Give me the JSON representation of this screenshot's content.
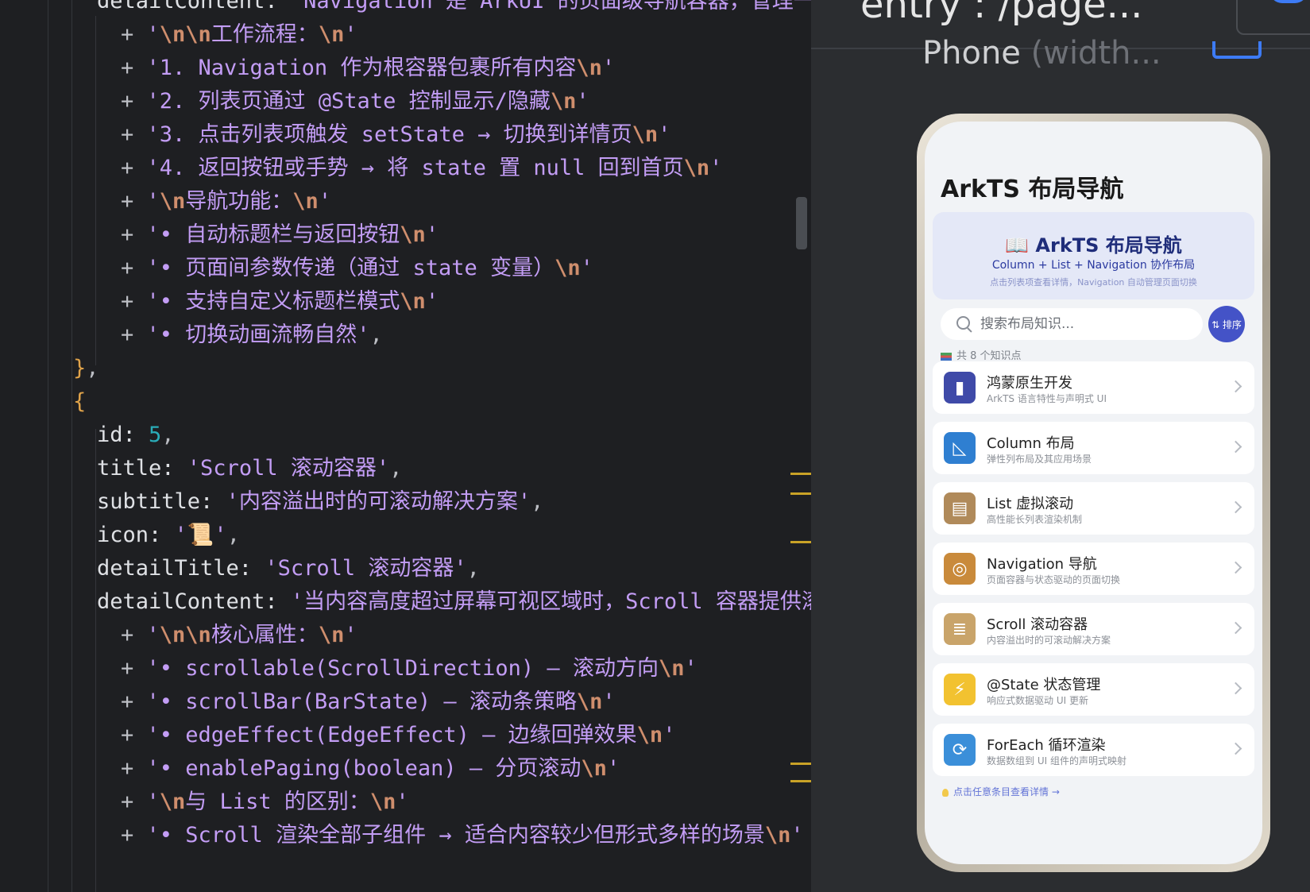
{
  "editor": {
    "lines": [
      {
        "indent": 122,
        "parts": [
          [
            "prop",
            "detailContent: "
          ],
          [
            "str",
            "'Navigation 是 ArkUI 的页面级导航容器，管理一级"
          ]
        ]
      },
      {
        "indent": 152,
        "parts": [
          [
            "plus",
            "+ "
          ],
          [
            "str",
            "'"
          ],
          [
            "esc",
            "\\n\\n"
          ],
          [
            "str",
            "工作流程："
          ],
          [
            "esc",
            "\\n"
          ],
          [
            "str",
            "'"
          ]
        ]
      },
      {
        "indent": 152,
        "parts": [
          [
            "plus",
            "+ "
          ],
          [
            "str",
            "'1. Navigation 作为根容器包裹所有内容"
          ],
          [
            "esc",
            "\\n"
          ],
          [
            "str",
            "'"
          ]
        ]
      },
      {
        "indent": 152,
        "parts": [
          [
            "plus",
            "+ "
          ],
          [
            "str",
            "'2. 列表页通过 @State 控制显示/隐藏"
          ],
          [
            "esc",
            "\\n"
          ],
          [
            "str",
            "'"
          ]
        ]
      },
      {
        "indent": 152,
        "parts": [
          [
            "plus",
            "+ "
          ],
          [
            "str",
            "'3. 点击列表项触发 setState → 切换到详情页"
          ],
          [
            "esc",
            "\\n"
          ],
          [
            "str",
            "'"
          ]
        ]
      },
      {
        "indent": 152,
        "parts": [
          [
            "plus",
            "+ "
          ],
          [
            "str",
            "'4. 返回按钮或手势 → 将 state 置 null 回到首页"
          ],
          [
            "esc",
            "\\n"
          ],
          [
            "str",
            "'"
          ]
        ]
      },
      {
        "indent": 152,
        "parts": [
          [
            "plus",
            "+ "
          ],
          [
            "str",
            "'"
          ],
          [
            "esc",
            "\\n"
          ],
          [
            "str",
            "导航功能："
          ],
          [
            "esc",
            "\\n"
          ],
          [
            "str",
            "'"
          ]
        ]
      },
      {
        "indent": 152,
        "parts": [
          [
            "plus",
            "+ "
          ],
          [
            "str",
            "'• 自动标题栏与返回按钮"
          ],
          [
            "esc",
            "\\n"
          ],
          [
            "str",
            "'"
          ]
        ]
      },
      {
        "indent": 152,
        "parts": [
          [
            "plus",
            "+ "
          ],
          [
            "str",
            "'• 页面间参数传递（通过 state 变量）"
          ],
          [
            "esc",
            "\\n"
          ],
          [
            "str",
            "'"
          ]
        ]
      },
      {
        "indent": 152,
        "parts": [
          [
            "plus",
            "+ "
          ],
          [
            "str",
            "'• 支持自定义标题栏模式"
          ],
          [
            "esc",
            "\\n"
          ],
          [
            "str",
            "'"
          ]
        ]
      },
      {
        "indent": 152,
        "parts": [
          [
            "plus",
            "+ "
          ],
          [
            "str",
            "'• 切换动画流畅自然'"
          ],
          [
            "plus",
            ","
          ]
        ]
      },
      {
        "indent": 92,
        "parts": [
          [
            "brace",
            "}"
          ],
          [
            "plus",
            ","
          ]
        ]
      },
      {
        "indent": 92,
        "parts": [
          [
            "brace",
            "{"
          ]
        ]
      },
      {
        "indent": 122,
        "parts": [
          [
            "prop",
            "id: "
          ],
          [
            "num",
            "5"
          ],
          [
            "plus",
            ","
          ]
        ]
      },
      {
        "indent": 122,
        "parts": [
          [
            "prop",
            "title: "
          ],
          [
            "str",
            "'Scroll 滚动容器'"
          ],
          [
            "plus",
            ","
          ]
        ]
      },
      {
        "indent": 122,
        "parts": [
          [
            "prop",
            "subtitle: "
          ],
          [
            "str",
            "'内容溢出时的可滚动解决方案'"
          ],
          [
            "plus",
            ","
          ]
        ]
      },
      {
        "indent": 122,
        "parts": [
          [
            "prop",
            "icon: "
          ],
          [
            "str",
            "'📜'"
          ],
          [
            "plus",
            ","
          ]
        ]
      },
      {
        "indent": 122,
        "parts": [
          [
            "prop",
            "detailTitle: "
          ],
          [
            "str",
            "'Scroll 滚动容器'"
          ],
          [
            "plus",
            ","
          ]
        ]
      },
      {
        "indent": 122,
        "parts": [
          [
            "prop",
            "detailContent: "
          ],
          [
            "str",
            "'当内容高度超过屏幕可视区域时，Scroll 容器提供滚动"
          ]
        ]
      },
      {
        "indent": 152,
        "parts": [
          [
            "plus",
            "+ "
          ],
          [
            "str",
            "'"
          ],
          [
            "esc",
            "\\n\\n"
          ],
          [
            "str",
            "核心属性："
          ],
          [
            "esc",
            "\\n"
          ],
          [
            "str",
            "'"
          ]
        ]
      },
      {
        "indent": 152,
        "parts": [
          [
            "plus",
            "+ "
          ],
          [
            "str",
            "'• scrollable(ScrollDirection) — 滚动方向"
          ],
          [
            "esc",
            "\\n"
          ],
          [
            "str",
            "'"
          ]
        ]
      },
      {
        "indent": 152,
        "parts": [
          [
            "plus",
            "+ "
          ],
          [
            "str",
            "'• scrollBar(BarState) — 滚动条策略"
          ],
          [
            "esc",
            "\\n"
          ],
          [
            "str",
            "'"
          ]
        ]
      },
      {
        "indent": 152,
        "parts": [
          [
            "plus",
            "+ "
          ],
          [
            "str",
            "'• edgeEffect(EdgeEffect) — 边缘回弹效果"
          ],
          [
            "esc",
            "\\n"
          ],
          [
            "str",
            "'"
          ]
        ]
      },
      {
        "indent": 152,
        "parts": [
          [
            "plus",
            "+ "
          ],
          [
            "str",
            "'• enablePaging(boolean) — 分页滚动"
          ],
          [
            "esc",
            "\\n"
          ],
          [
            "str",
            "'"
          ]
        ]
      },
      {
        "indent": 152,
        "parts": [
          [
            "plus",
            "+ "
          ],
          [
            "str",
            "'"
          ],
          [
            "esc",
            "\\n"
          ],
          [
            "str",
            "与 List 的区别："
          ],
          [
            "esc",
            "\\n"
          ],
          [
            "str",
            "'"
          ]
        ]
      },
      {
        "indent": 152,
        "parts": [
          [
            "plus",
            "+ "
          ],
          [
            "str",
            "'• Scroll 渲染全部子组件 → 适合内容较少但形式多样的场景"
          ],
          [
            "esc",
            "\\n"
          ],
          [
            "str",
            "'"
          ]
        ]
      }
    ]
  },
  "preview": {
    "header_title": "entry : /page...",
    "device_label": "Phone",
    "device_label_muted": " (width...",
    "app_title": "ArkTS 布局导航",
    "hero": {
      "title": "📖 ArkTS 布局导航",
      "subtitle": "Column + List + Navigation 协作布局",
      "hint": "点击列表项查看详情，Navigation 自动管理页面切换"
    },
    "search": {
      "placeholder": "搜索布局知识..."
    },
    "sort_label": "⇅ 排序",
    "count_label": "共 8 个知识点",
    "items": [
      {
        "icon": "phone-icon",
        "glyph": "▮",
        "color": "#3f4aa8",
        "title": "鸿蒙原生开发",
        "subtitle": "ArkTS 语言特性与声明式 UI"
      },
      {
        "icon": "triangle-ruler-icon",
        "glyph": "◺",
        "color": "#2f7fd1",
        "title": "Column 布局",
        "subtitle": "弹性列布局及其应用场景"
      },
      {
        "icon": "clipboard-icon",
        "glyph": "▤",
        "color": "#b08a5a",
        "title": "List 虚拟滚动",
        "subtitle": "高性能长列表渲染机制"
      },
      {
        "icon": "compass-icon",
        "glyph": "◎",
        "color": "#c98a3b",
        "title": "Navigation 导航",
        "subtitle": "页面容器与状态驱动的页面切换"
      },
      {
        "icon": "scroll-icon",
        "glyph": "≣",
        "color": "#c9a46a",
        "title": "Scroll 滚动容器",
        "subtitle": "内容溢出时的可滚动解决方案"
      },
      {
        "icon": "lightning-icon",
        "glyph": "⚡",
        "color": "#f2c230",
        "title": "@State 状态管理",
        "subtitle": "响应式数据驱动 UI 更新"
      },
      {
        "icon": "refresh-icon",
        "glyph": "⟳",
        "color": "#3b8fd9",
        "title": "ForEach 循环渲染",
        "subtitle": "数据数组到 UI 组件的声明式映射"
      }
    ],
    "footer_hint": "点击任意条目查看详情 →"
  }
}
